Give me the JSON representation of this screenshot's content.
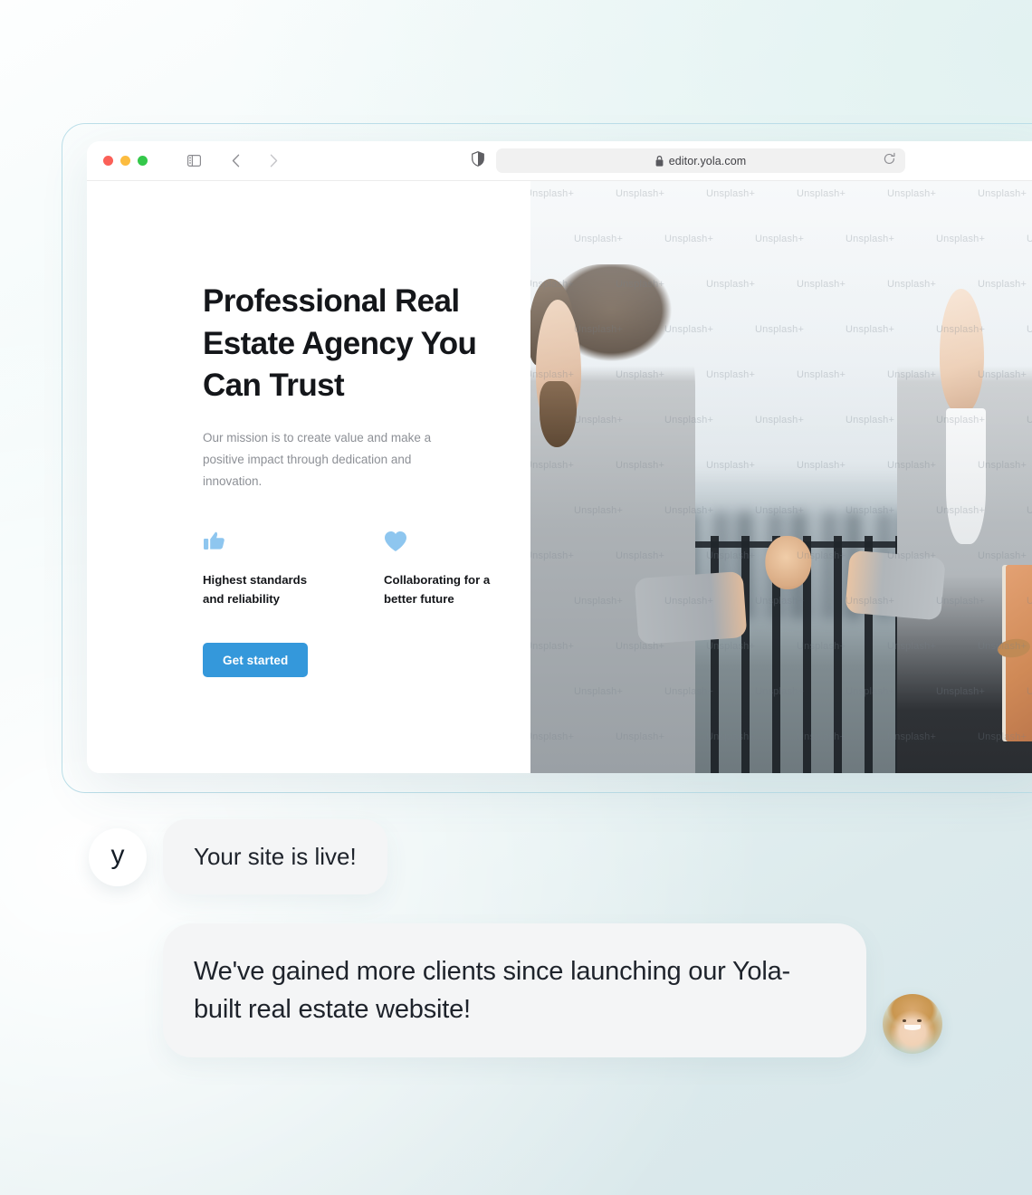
{
  "browser": {
    "window_controls": [
      "close",
      "minimize",
      "maximize"
    ],
    "sidebar_toggle_icon": "sidebar-toggle-icon",
    "back_icon": "chevron-left-icon",
    "forward_icon": "chevron-right-icon",
    "shield_icon": "privacy-shield-icon",
    "lock_icon": "lock-icon",
    "reload_icon": "reload-icon",
    "url": "editor.yola.com"
  },
  "site": {
    "hero": {
      "title": "Professional Real Estate Agency You Can Trust",
      "subtitle": "Our mission is to create value and make a positive impact through dedication and innovation.",
      "cta_label": "Get started",
      "cta_color": "#3498db"
    },
    "features": [
      {
        "icon": "thumbs-up-icon",
        "label": "Highest standards and reliability",
        "color": "#8ec6ef"
      },
      {
        "icon": "heart-icon",
        "label": "Collaborating for a better future",
        "color": "#8ec6ef"
      }
    ],
    "hero_image": {
      "alt": "Two business people shaking hands on a rooftop terrace",
      "watermark_text": "Unsplash+"
    }
  },
  "chat": {
    "messages": [
      {
        "avatar": "yola-logo-avatar",
        "avatar_letter": "y",
        "text": "Your site is live!"
      },
      {
        "avatar": "customer-photo-avatar",
        "text": "We've gained more clients since launching our Yola-built real estate website!"
      }
    ]
  },
  "theme": {
    "background_from": "#fdfefe",
    "background_to": "#d6e6ea",
    "bubble_bg": "#f4f5f6",
    "accent": "#3498db",
    "heading_color": "#14161a",
    "muted_text": "#8d9096"
  }
}
